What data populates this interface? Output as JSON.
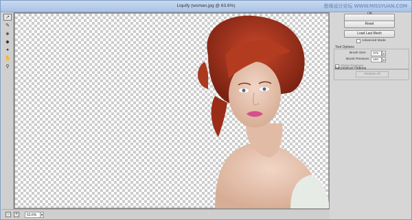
{
  "window": {
    "title": "Liquify (woman.jpg @ 63.6%)",
    "watermark": "思缘设计论坛 WWW.MISSYUAN.COM"
  },
  "toolbox": {
    "tools": [
      {
        "icon": "forward-warp-icon",
        "glyph": "↗"
      },
      {
        "icon": "reconstruct-icon",
        "glyph": "✎"
      },
      {
        "icon": "twirl-icon",
        "glyph": "◈"
      },
      {
        "icon": "pucker-icon",
        "glyph": "◆"
      },
      {
        "icon": "bloat-icon",
        "glyph": "✦"
      },
      {
        "icon": "hand-icon",
        "glyph": "✋"
      },
      {
        "icon": "zoom-icon",
        "glyph": "⚲"
      }
    ]
  },
  "status": {
    "zoom_out": "−",
    "zoom_in": "+",
    "zoom_value": "63.6%",
    "zoom_caret": "▾"
  },
  "panel": {
    "ok_label": "OK",
    "reset_label": "Reset",
    "load_mesh_label": "Load Last Mesh",
    "advanced_mode_label": "Advanced Mode",
    "tool_options_title": "Tool Options",
    "brush_size_label": "Brush Size:",
    "brush_size_value": "375",
    "brush_pressure_label": "Brush Pressure:",
    "brush_pressure_value": "100",
    "stylus_label": "Stylus Pressure",
    "reconstruct_title": "Reconstruct Options",
    "restore_all_label": "Restore All",
    "caret": "▾"
  },
  "colors": {
    "titlebar": "#b7cdea",
    "window_bg": "#d6d6d6",
    "hair": "#a8321c"
  }
}
